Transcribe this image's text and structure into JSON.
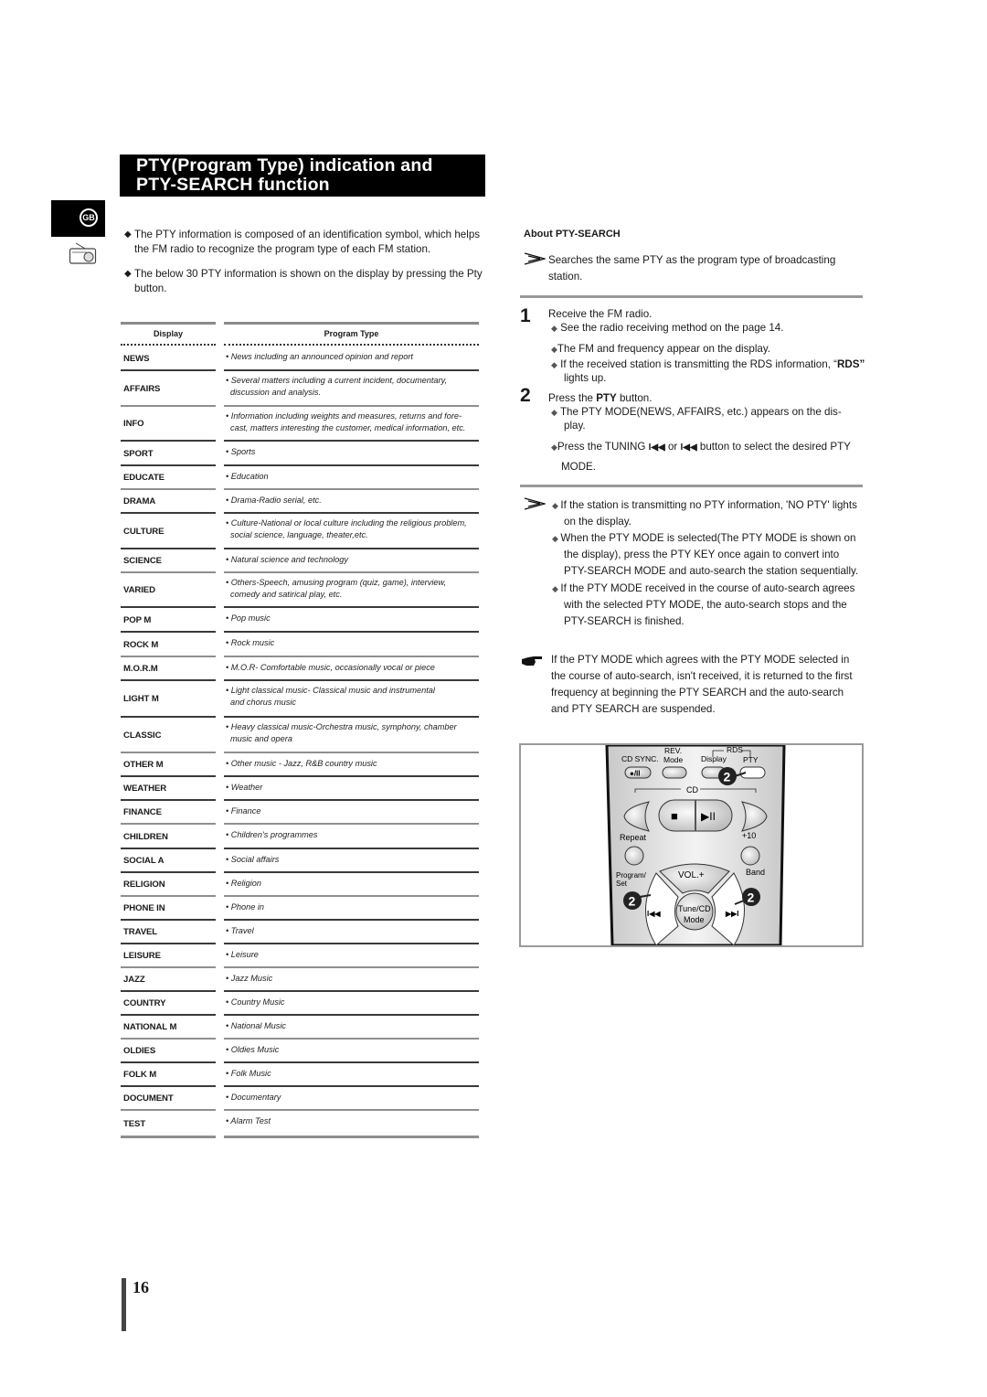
{
  "header": {
    "title_line1": "PTY(Program Type) indication and",
    "title_line2": "PTY-SEARCH function",
    "language_badge": "GB",
    "section_icon": "radio-icon"
  },
  "intro": {
    "bullet_icon": "diamond-bullet",
    "bullets": [
      "The PTY information is composed of an identification symbol, which helps the FM radio to recognize the program type of each FM station.",
      "The below 30 PTY information is shown on the display by pressing the Pty button."
    ]
  },
  "pty_table": {
    "headers": {
      "display": "Display",
      "program_type": "Program Type"
    },
    "rows": [
      {
        "display": "NEWS",
        "desc": [
          "• News including an announced opinion and report"
        ]
      },
      {
        "display": "AFFAIRS",
        "desc": [
          "• Several matters including a current incident, documentary,",
          "discussion and analysis."
        ]
      },
      {
        "display": "INFO",
        "desc": [
          "•  Information including weights and measures, returns and fore-",
          "cast, matters interesting the customer, medical information, etc."
        ]
      },
      {
        "display": "SPORT",
        "desc": [
          "• Sports"
        ]
      },
      {
        "display": "EDUCATE",
        "desc": [
          "• Education"
        ]
      },
      {
        "display": "DRAMA",
        "desc": [
          "• Drama-Radio serial, etc."
        ]
      },
      {
        "display": "CULTURE",
        "desc": [
          "• Culture-National or local culture including the religious problem,",
          "social science, language, theater,etc."
        ]
      },
      {
        "display": "SCIENCE",
        "desc": [
          "• Natural science and technology"
        ]
      },
      {
        "display": "VARIED",
        "desc": [
          "• Others-Speech, amusing program (quiz, game), interview,",
          "comedy and satirical play, etc."
        ]
      },
      {
        "display": "POP M",
        "desc": [
          "• Pop music"
        ]
      },
      {
        "display": "ROCK M",
        "desc": [
          "• Rock music"
        ]
      },
      {
        "display": "M.O.R.M",
        "desc": [
          "• M.O.R- Comfortable music, occasionally vocal or piece"
        ]
      },
      {
        "display": "LIGHT M",
        "desc": [
          "• Light classical music- Classical music and instrumental",
          "and chorus music"
        ]
      },
      {
        "display": "CLASSIC",
        "desc": [
          "• Heavy classical  music-Orchestra music, symphony, chamber",
          "music and opera"
        ]
      },
      {
        "display": "OTHER M",
        "desc": [
          "• Other music - Jazz, R&B country music"
        ]
      },
      {
        "display": "WEATHER",
        "desc": [
          "• Weather"
        ]
      },
      {
        "display": "FINANCE",
        "desc": [
          "• Finance"
        ]
      },
      {
        "display": "CHILDREN",
        "desc": [
          "• Children's programmes"
        ]
      },
      {
        "display": "SOCIAL  A",
        "desc": [
          "• Social affairs"
        ]
      },
      {
        "display": "RELIGION",
        "desc": [
          "• Religion"
        ]
      },
      {
        "display": "PHONE IN",
        "desc": [
          "• Phone in"
        ]
      },
      {
        "display": "TRAVEL",
        "desc": [
          "• Travel"
        ]
      },
      {
        "display": "LEISURE",
        "desc": [
          "• Leisure"
        ]
      },
      {
        "display": "JAZZ",
        "desc": [
          "• Jazz Music"
        ]
      },
      {
        "display": "COUNTRY",
        "desc": [
          "• Country Music"
        ]
      },
      {
        "display": "NATIONAL M",
        "desc": [
          "• National Music"
        ]
      },
      {
        "display": "OLDIES",
        "desc": [
          "• Oldies Music"
        ]
      },
      {
        "display": "FOLK M",
        "desc": [
          "• Folk Music"
        ]
      },
      {
        "display": "DOCUMENT",
        "desc": [
          "• Documentary"
        ]
      },
      {
        "display": "TEST",
        "desc": [
          "• Alarm Test"
        ]
      }
    ]
  },
  "about": {
    "heading": "About PTY-SEARCH",
    "summary_line1": "Searches the same PTY as the program type of broadcasting",
    "summary_line2": "station.",
    "steps": [
      {
        "num": "1",
        "text": "Receive the FM radio.",
        "notes": [
          "See the radio receiving method on the page 14.",
          "The FM and frequency appear on the display.",
          "If the received station is transmitting the RDS information, “",
          "RDS",
          "”",
          "lights up."
        ]
      },
      {
        "num": "2",
        "text_pre": "Press the ",
        "text_bold": "PTY",
        "text_post": " button.",
        "notes": [
          "The PTY MODE(NEWS, AFFAIRS, etc.) appears on the dis-",
          "play.",
          "Press the TUNING ",
          " or ",
          " button to select the desired PTY",
          "MODE."
        ]
      }
    ],
    "tips": [
      [
        "If the station is transmitting no PTY information, 'NO PTY' lights",
        "on the display."
      ],
      [
        "When the PTY MODE is selected(The PTY MODE is shown on",
        "the display), press the PTY KEY once again to convert into",
        "PTY-SEARCH MODE and auto-search the station sequentially."
      ],
      [
        "If the PTY MODE received in the course of auto-search agrees",
        "with the selected PTY MODE, the auto-search stops and the",
        "PTY-SEARCH is finished."
      ]
    ],
    "note": [
      "If the PTY MODE which agrees with the PTY MODE selected in",
      "the course of auto-search, isn't received, it is returned to the first",
      "frequency at beginning the PTY SEARCH and the auto-search",
      "and PTY SEARCH are suspended."
    ]
  },
  "remote": {
    "labels": {
      "cd_sync": "CD SYNC.",
      "rev": "REV.",
      "mode": "Mode",
      "rds": "RDS",
      "display": "Display",
      "pty": "PTY",
      "cd_sync_btn": "●/II",
      "cd": "CD",
      "stop": "■",
      "play_pause": "▶II",
      "repeat": "Repeat",
      "plus10": "+10",
      "program_set_1": "Program/",
      "program_set_2": "Set",
      "vol_plus": "VOL.+",
      "band": "Band",
      "tune_cd_1": "Tune/CD",
      "tune_cd_2": "Mode",
      "prev": "I◀◀",
      "next": "▶▶I",
      "callout": "2"
    }
  },
  "footer": {
    "page_number": "16"
  }
}
